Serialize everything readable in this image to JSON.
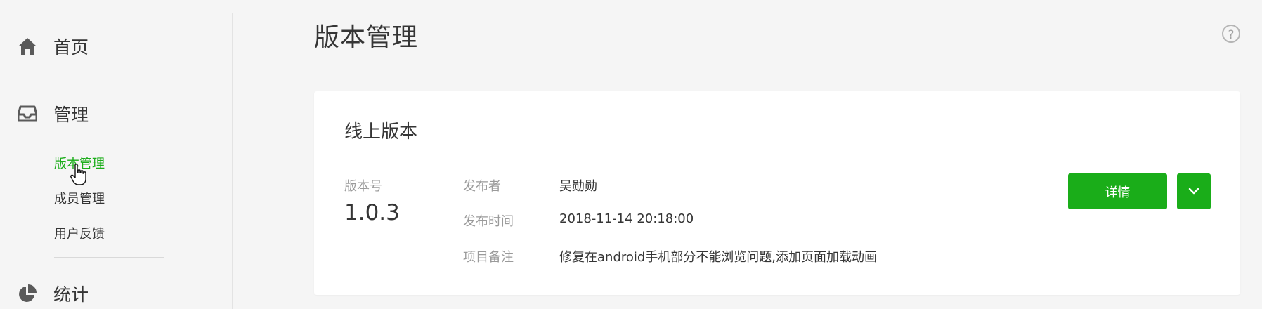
{
  "sidebar": {
    "home": {
      "label": "首页",
      "icon": "home-icon"
    },
    "manage": {
      "label": "管理",
      "icon": "inbox-icon",
      "sub_items": [
        {
          "label": "版本管理",
          "active": true
        },
        {
          "label": "成员管理",
          "active": false
        },
        {
          "label": "用户反馈",
          "active": false
        }
      ]
    },
    "stats": {
      "label": "统计",
      "icon": "pie-chart-icon"
    }
  },
  "main": {
    "title": "版本管理",
    "help_symbol": "?",
    "card": {
      "title": "线上版本",
      "version_label": "版本号",
      "version_value": "1.0.3",
      "meta": [
        {
          "key": "发布者",
          "value": "吴勋勋"
        },
        {
          "key": "发布时间",
          "value": "2018-11-14 20:18:00"
        },
        {
          "key": "项目备注",
          "value": "修复在android手机部分不能浏览问题,添加页面加载动画"
        }
      ],
      "detail_button": "详情"
    }
  },
  "colors": {
    "accent": "#1aad19",
    "text_primary": "#353535",
    "text_secondary": "#9a9a9a",
    "background": "#f5f5f5"
  }
}
